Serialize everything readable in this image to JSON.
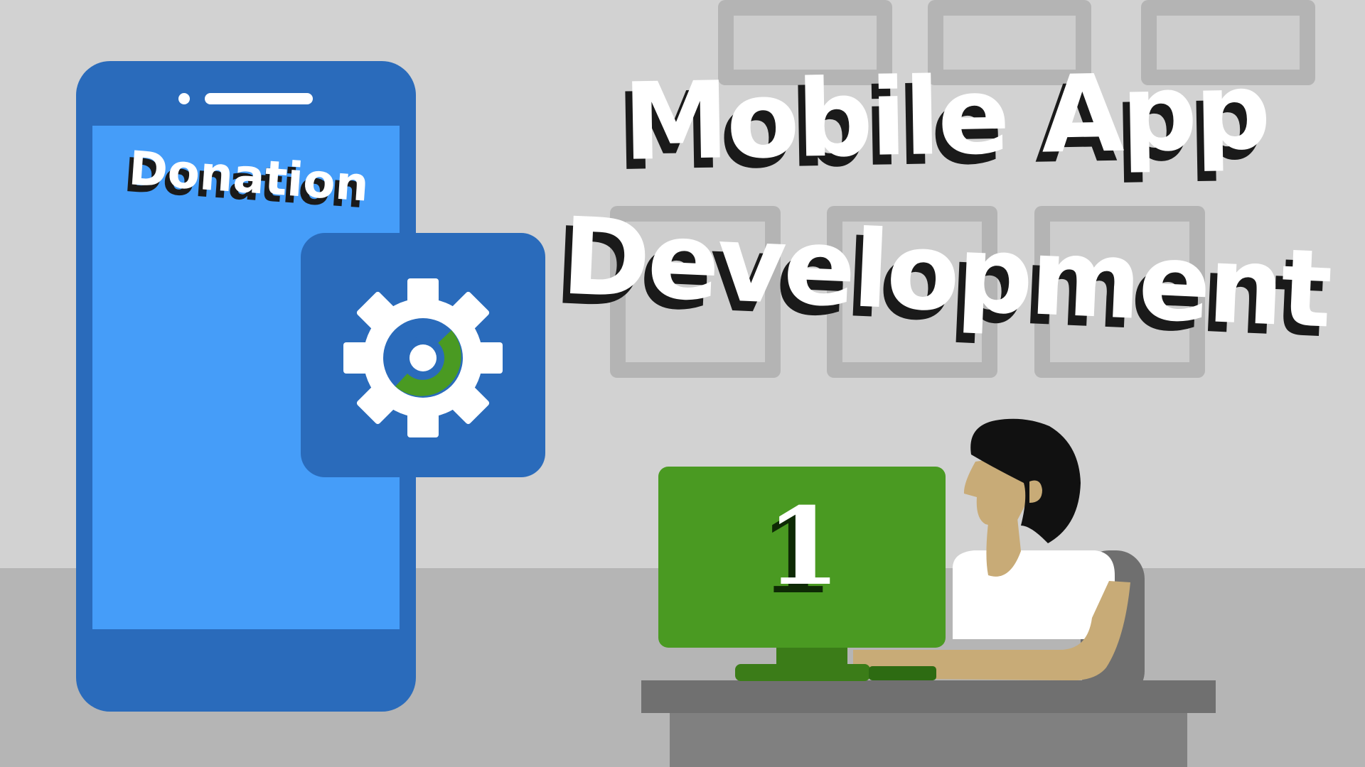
{
  "title": {
    "line1": "Mobile App",
    "line2": "Development"
  },
  "phone": {
    "app_name": "Donation"
  },
  "monitor": {
    "number": "1"
  },
  "icons": {
    "settings": "gear-icon",
    "person": "developer-illustration"
  },
  "colors": {
    "background": "#d2d2d2",
    "phone_body": "#2a6bbb",
    "phone_screen": "#459df9",
    "monitor": "#4a9a22",
    "gear_ring_accent": "#4a9a22"
  }
}
